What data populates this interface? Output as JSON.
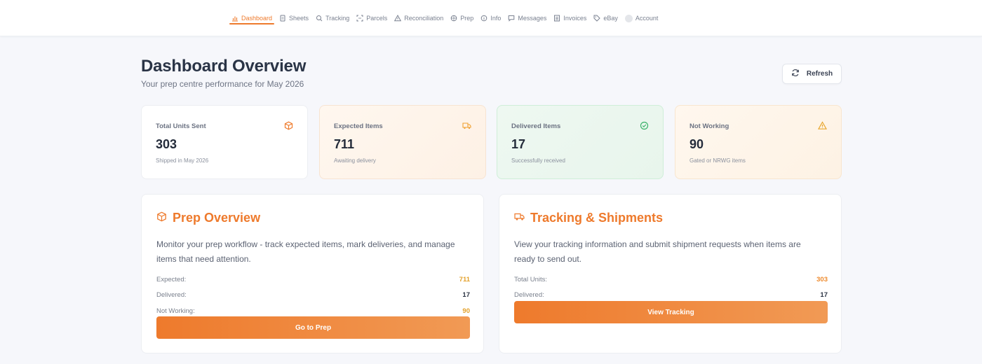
{
  "nav": {
    "items": [
      {
        "label": "Dashboard",
        "icon": "chart-icon",
        "active": true
      },
      {
        "label": "Sheets",
        "icon": "sheet-icon",
        "active": false
      },
      {
        "label": "Tracking",
        "icon": "search-icon",
        "active": false
      },
      {
        "label": "Parcels",
        "icon": "parcel-icon",
        "active": false
      },
      {
        "label": "Reconciliation",
        "icon": "warning-icon",
        "active": false
      },
      {
        "label": "Prep",
        "icon": "box-icon",
        "active": false
      },
      {
        "label": "Info",
        "icon": "info-icon",
        "active": false
      },
      {
        "label": "Messages",
        "icon": "message-icon",
        "active": false
      },
      {
        "label": "Invoices",
        "icon": "invoice-icon",
        "active": false
      },
      {
        "label": "eBay",
        "icon": "tag-icon",
        "active": false
      },
      {
        "label": "Account",
        "icon": "avatar-icon",
        "active": false
      }
    ],
    "accent": "#ee7a2c"
  },
  "header": {
    "title": "Dashboard Overview",
    "subtitle": "Your prep centre performance for May 2026",
    "refresh_label": "Refresh"
  },
  "stats": [
    {
      "label": "Total Units Sent",
      "value": "303",
      "note": "Shipped in May 2026",
      "icon": "box-icon",
      "icon_color": "#ee7a2c"
    },
    {
      "label": "Expected Items",
      "value": "711",
      "note": "Awaiting delivery",
      "icon": "truck-icon",
      "icon_color": "#f0a030"
    },
    {
      "label": "Delivered Items",
      "value": "17",
      "note": "Successfully received",
      "icon": "check-circle-icon",
      "icon_color": "#3bb36b"
    },
    {
      "label": "Not Working",
      "value": "90",
      "note": "Gated or NRWG items",
      "icon": "warning-icon",
      "icon_color": "#e9a62c"
    }
  ],
  "prep_panel": {
    "title": "Prep Overview",
    "description": "Monitor your prep workflow - track expected items, mark deliveries, and manage items that need attention.",
    "rows": [
      {
        "label": "Expected:",
        "value": "711"
      },
      {
        "label": "Delivered:",
        "value": "17"
      },
      {
        "label": "Not Working:",
        "value": "90"
      }
    ],
    "button_label": "Go to Prep"
  },
  "tracking_panel": {
    "title": "Tracking & Shipments",
    "description": "View your tracking information and submit shipment requests when items are ready to send out.",
    "rows": [
      {
        "label": "Total Units:",
        "value": "303"
      },
      {
        "label": "Delivered:",
        "value": "17"
      }
    ],
    "button_label": "View Tracking"
  }
}
